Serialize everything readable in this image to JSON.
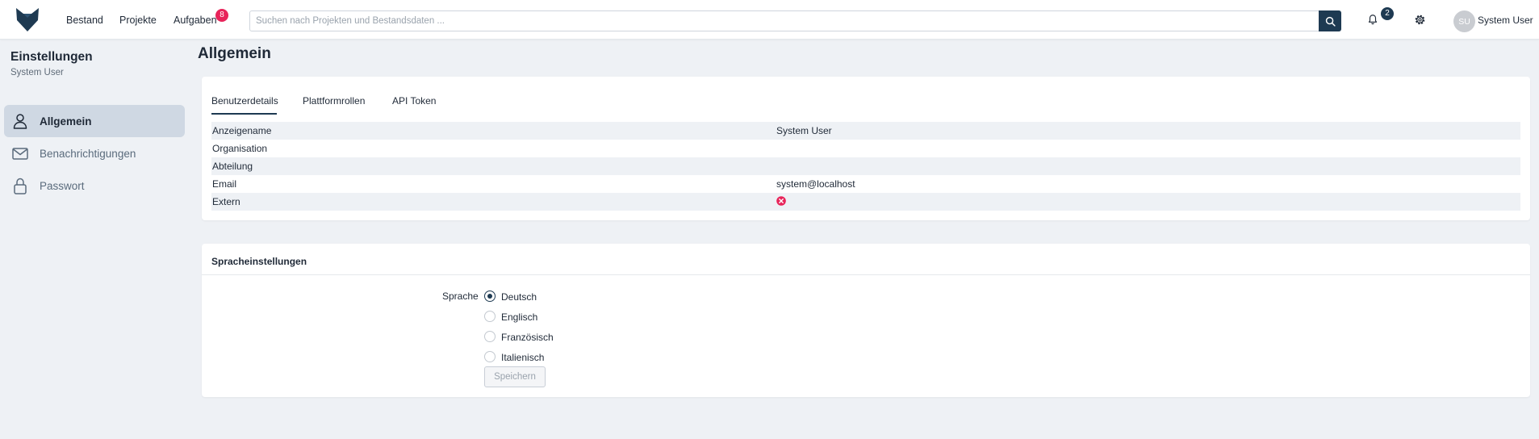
{
  "nav": {
    "items": [
      {
        "label": "Bestand"
      },
      {
        "label": "Projekte"
      },
      {
        "label": "Aufgaben",
        "badge": "8"
      }
    ],
    "search": {
      "placeholder": "Suchen nach Projekten und Bestandsdaten ...",
      "value": ""
    },
    "notifications_count": "2",
    "user": {
      "initials": "SU",
      "name": "System User"
    }
  },
  "sidebar": {
    "title": "Einstellungen",
    "subtitle": "System User",
    "items": [
      {
        "label": "Allgemein",
        "icon": "user-icon",
        "active": true
      },
      {
        "label": "Benachrichtigungen",
        "icon": "mail-icon",
        "active": false
      },
      {
        "label": "Passwort",
        "icon": "lock-icon",
        "active": false
      }
    ]
  },
  "main": {
    "title": "Allgemein",
    "tabs": [
      {
        "label": "Benutzerdetails",
        "active": true
      },
      {
        "label": "Plattformrollen",
        "active": false
      },
      {
        "label": "API Token",
        "active": false
      }
    ],
    "details": [
      {
        "label": "Anzeigename",
        "value": "System User"
      },
      {
        "label": "Organisation",
        "value": ""
      },
      {
        "label": "Abteilung",
        "value": ""
      },
      {
        "label": "Email",
        "value": "system@localhost"
      },
      {
        "label": "Extern",
        "value": "",
        "icon": "x-circle-icon"
      }
    ],
    "language": {
      "header": "Spracheinstellungen",
      "label": "Sprache",
      "options": [
        {
          "label": "Deutsch",
          "selected": true
        },
        {
          "label": "Englisch",
          "selected": false
        },
        {
          "label": "Französisch",
          "selected": false
        },
        {
          "label": "Italienisch",
          "selected": false
        }
      ],
      "save_label": "Speichern"
    }
  },
  "colors": {
    "primary": "#1e3a52",
    "badge_red": "#e8245a",
    "background": "#eef1f5",
    "sidebar_active": "#cfd8e3"
  }
}
